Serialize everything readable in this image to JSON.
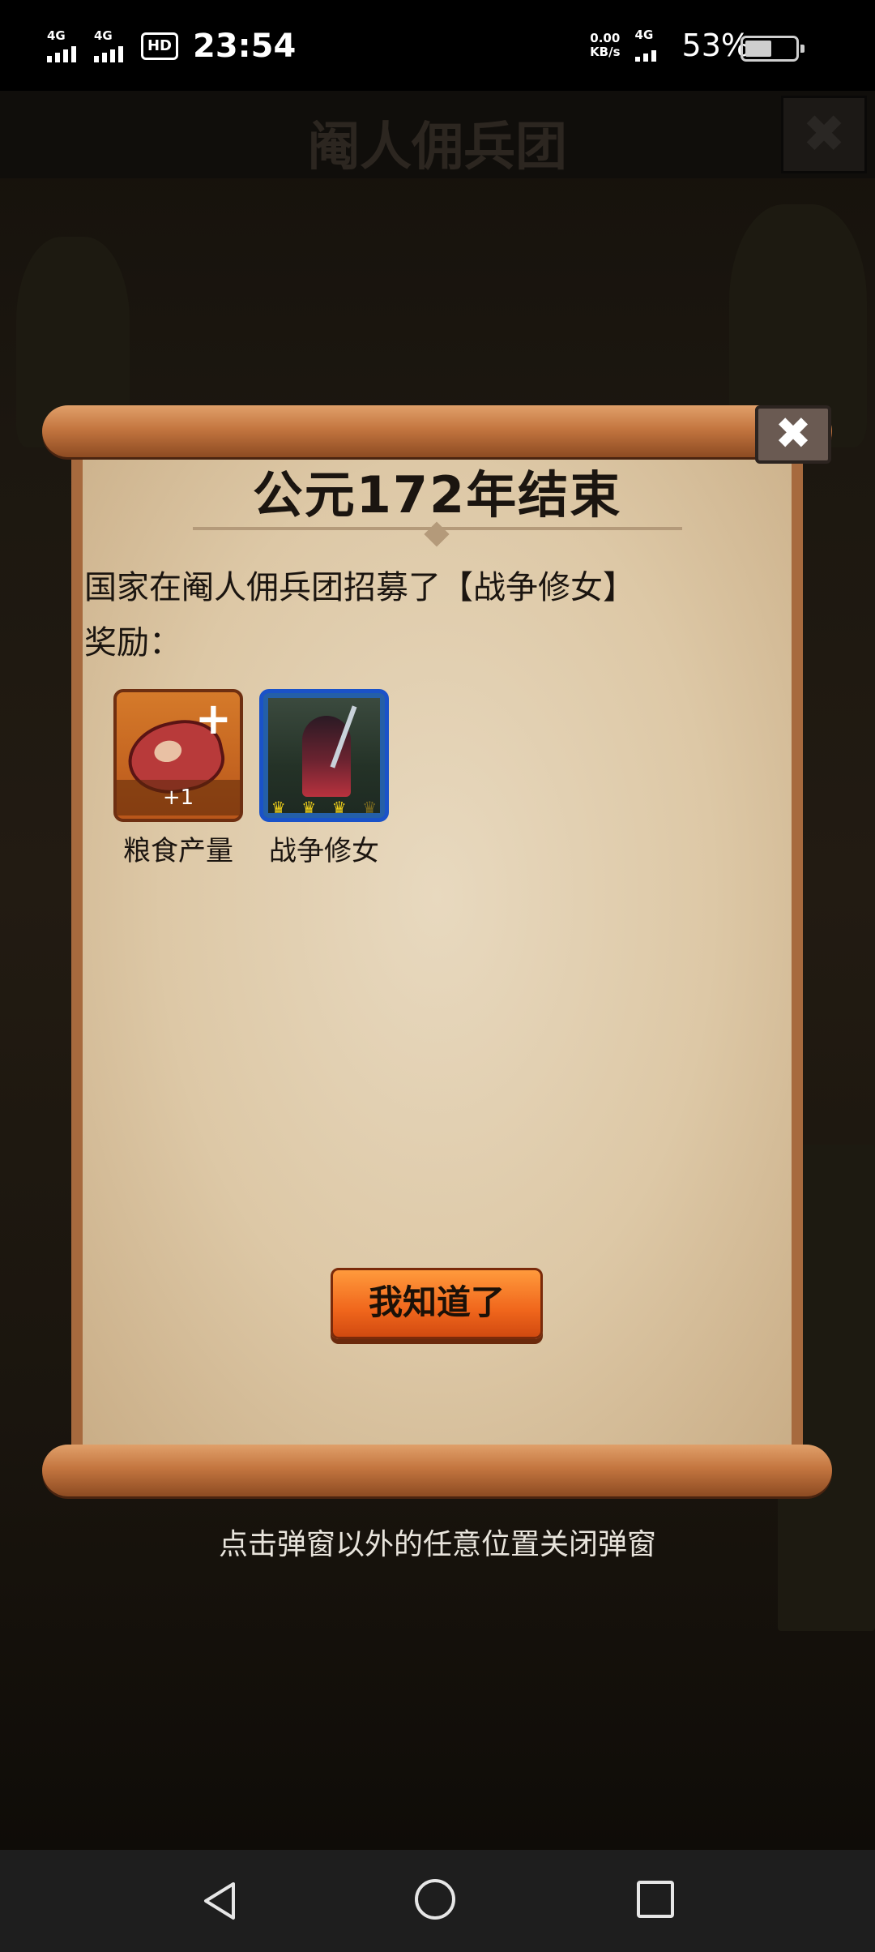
{
  "status_bar": {
    "network1": "4G",
    "network2": "4G",
    "hd": "HD",
    "time": "23:54",
    "speed_value": "0.00",
    "speed_unit": "KB/s",
    "network3": "4G",
    "battery_percent": "53%",
    "battery_level": 0.53
  },
  "game_header": {
    "title": "阉人佣兵团",
    "close_symbol": "✖"
  },
  "popup": {
    "title": "公元172年结束",
    "message": "国家在阉人佣兵团招募了【战争修女】",
    "reward_label": "奖励：",
    "close_symbol": "✖",
    "rewards": [
      {
        "name": "粮食产量",
        "amount": "+1",
        "icon": "steak-icon",
        "plus": "+"
      },
      {
        "name": "战争修女",
        "icon": "war-nun-portrait",
        "stars": [
          "♛",
          "♛",
          "♛",
          "♛"
        ]
      }
    ],
    "confirm_button": "我知道了",
    "hint": "点击弹窗以外的任意位置关闭弹窗"
  },
  "nav_bar": {
    "back": "back-icon",
    "home": "home-icon",
    "recent": "recent-apps-icon"
  }
}
